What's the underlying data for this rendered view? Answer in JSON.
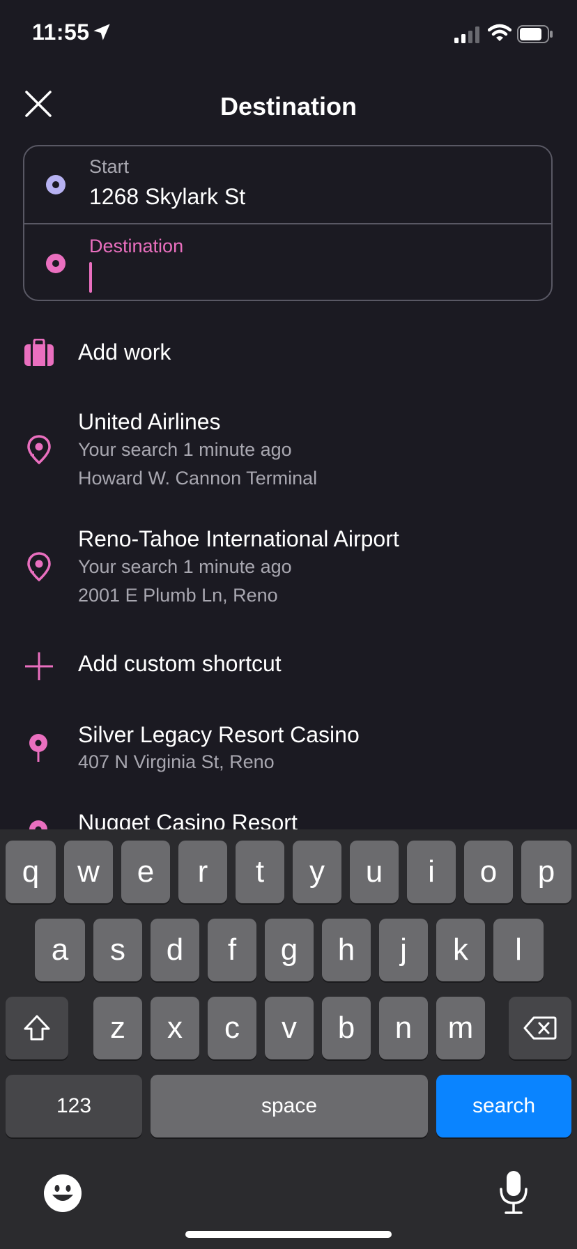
{
  "status_bar": {
    "time": "11:55"
  },
  "header": {
    "title": "Destination"
  },
  "route": {
    "start_label": "Start",
    "start_value": "1268 Skylark St",
    "destination_label": "Destination",
    "destination_value": ""
  },
  "shortcuts": {
    "add_work": "Add work",
    "add_custom": "Add custom shortcut"
  },
  "recent": [
    {
      "title": "United Airlines",
      "subtitle": "Your search 1 minute ago",
      "detail": "Howard W. Cannon Terminal"
    },
    {
      "title": "Reno-Tahoe International Airport",
      "subtitle": "Your search 1 minute ago",
      "detail": "2001 E Plumb Ln, Reno"
    }
  ],
  "places": [
    {
      "title": "Silver Legacy Resort Casino",
      "detail": "407 N Virginia St, Reno"
    },
    {
      "title": "Nugget Casino Resort"
    }
  ],
  "keyboard": {
    "row1": [
      "q",
      "w",
      "e",
      "r",
      "t",
      "y",
      "u",
      "i",
      "o",
      "p"
    ],
    "row2": [
      "a",
      "s",
      "d",
      "f",
      "g",
      "h",
      "j",
      "k",
      "l"
    ],
    "row3": [
      "z",
      "x",
      "c",
      "v",
      "b",
      "n",
      "m"
    ],
    "numbers_label": "123",
    "space_label": "space",
    "action_label": "search"
  },
  "icons": {
    "close": "close-icon",
    "briefcase": "briefcase-icon",
    "history_pin": "history-pin-icon",
    "plus": "plus-icon",
    "pin": "pin-icon",
    "shift": "shift-icon",
    "backspace": "backspace-icon",
    "emoji": "emoji-icon",
    "microphone": "microphone-icon"
  },
  "colors": {
    "background": "#1b1a22",
    "accent_pink": "#ea6fbf",
    "start_dot": "#b7b2f2",
    "search_key": "#0a84ff"
  }
}
